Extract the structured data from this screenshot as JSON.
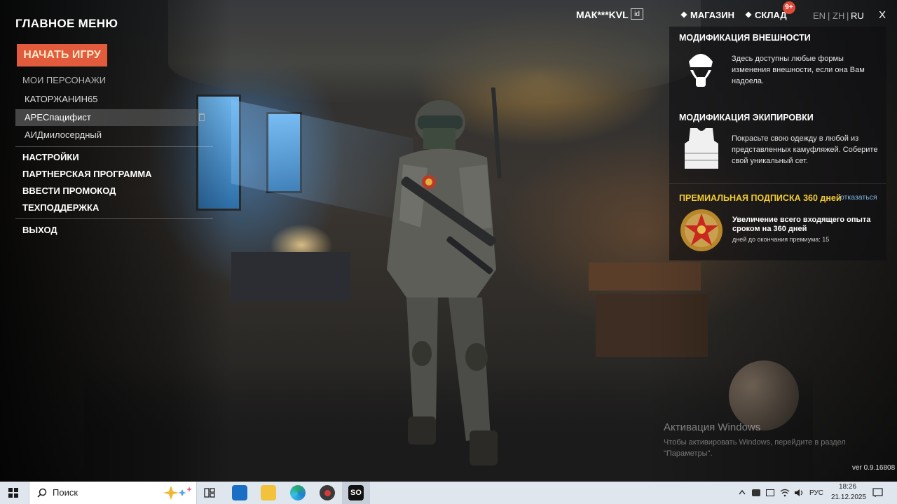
{
  "menu": {
    "title": "ГЛАВНОЕ МЕНЮ",
    "start_button": "НАЧАТЬ ИГРУ",
    "my_characters_label": "МОИ ПЕРСОНАЖИ",
    "characters": [
      "КАТОРЖАНИН65",
      "АРЕСпацифист",
      "АИДмилосердный"
    ],
    "selected_character": "АРЕСпацифист",
    "items": [
      "НАСТРОЙКИ",
      "ПАРТНЕРСКАЯ ПРОГРАММА",
      "ВВЕСТИ ПРОМОКОД",
      "ТЕХПОДДЕРЖКА"
    ],
    "exit": "ВЫХОД"
  },
  "topbar": {
    "username": "МАК***KVL",
    "id_icon_text": "id",
    "shop": "МАГАЗИН",
    "warehouse": "СКЛАД",
    "warehouse_badge": "9+",
    "languages": [
      "EN",
      "ZH",
      "RU"
    ],
    "active_language": "RU",
    "separator": "|",
    "close": "X"
  },
  "panel": {
    "appearance": {
      "title": "МОДИФИКАЦИЯ ВНЕШНОСТИ",
      "text": "Здесь доступны любые формы изменения внешности, если она Вам надоела."
    },
    "equipment": {
      "title": "МОДИФИКАЦИЯ ЭКИПИРОВКИ",
      "text": "Покрасьте свою одежду в любой из представленных камуфляжей. Соберите свой уникальный сет."
    },
    "premium": {
      "title": "ПРЕМИАЛЬНАЯ ПОДПИСКА 360 дней",
      "cancel": "отказаться",
      "description": "Увеличение всего входящего опыта сроком на 360 дней",
      "days_left": "дней до окончания премиума: 15"
    }
  },
  "watermark": {
    "title": "Активация Windows",
    "text": "Чтобы активировать Windows, перейдите в раздел \"Параметры\"."
  },
  "version": "ver 0.9.16808",
  "taskbar": {
    "search_placeholder": "Поиск",
    "language": "РУС",
    "time": "18:26",
    "date": "21.12.2025",
    "app_label": "SO"
  },
  "colors": {
    "start_button": "#e25b3c",
    "premium_title": "#f2cc33",
    "cancel_link": "#7fb6e8",
    "badge": "#e04a3a"
  }
}
